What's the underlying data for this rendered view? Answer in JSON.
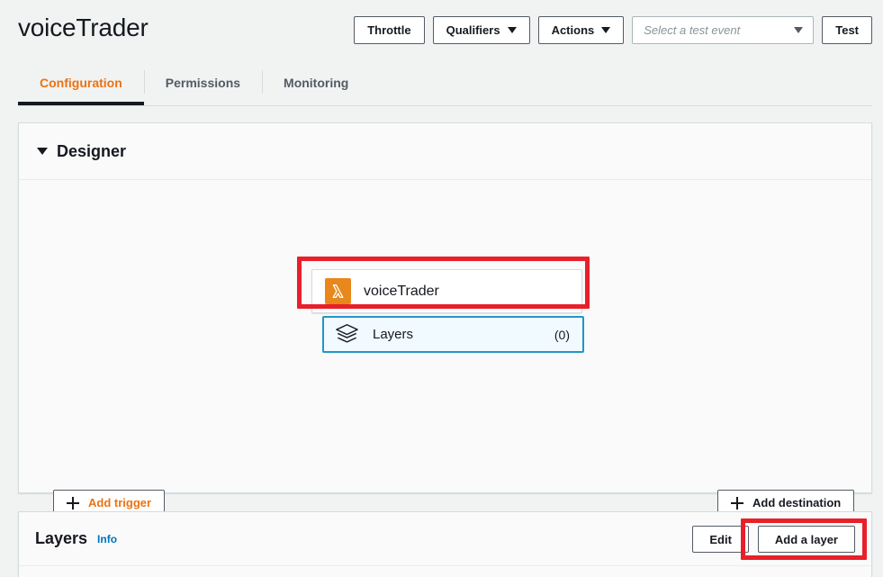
{
  "header": {
    "function_name": "voiceTrader",
    "buttons": [
      {
        "label": "Throttle",
        "has_caret": false
      },
      {
        "label": "Qualifiers",
        "has_caret": true
      },
      {
        "label": "Actions",
        "has_caret": true
      }
    ],
    "test_event_select": {
      "placeholder": "Select a test event",
      "value": "",
      "icon": "chevron-down-icon"
    },
    "test_button_label": "Test"
  },
  "tabs": [
    {
      "label": "Configuration",
      "active": true
    },
    {
      "label": "Permissions",
      "active": false
    },
    {
      "label": "Monitoring",
      "active": false
    }
  ],
  "designer": {
    "title": "Designer",
    "collapse_icon": "chevron-down-icon",
    "function_card": {
      "icon": "lambda-icon",
      "name": "voiceTrader"
    },
    "layers_node": {
      "icon": "layers-stack-icon",
      "label": "Layers",
      "count": "(0)",
      "selected": true,
      "highlighted": true
    },
    "add_trigger": {
      "label": "Add trigger",
      "icon": "plus-icon"
    },
    "add_destination": {
      "label": "Add destination",
      "icon": "plus-icon"
    }
  },
  "layers_section": {
    "title": "Layers",
    "info_link": "Info",
    "edit_button": "Edit",
    "add_layer_button": "Add a layer",
    "add_layer_highlighted": true
  },
  "colors": {
    "accent_orange": "#ec7211",
    "lambda_orange": "#e8871b",
    "link_blue": "#0073bb",
    "selected_border": "#2196c8",
    "selected_bg": "#f1faff",
    "annotation_red": "#e8202a",
    "text_dark": "#16191f",
    "page_bg": "#f1f3f3",
    "panel_bg": "#fafafa"
  }
}
